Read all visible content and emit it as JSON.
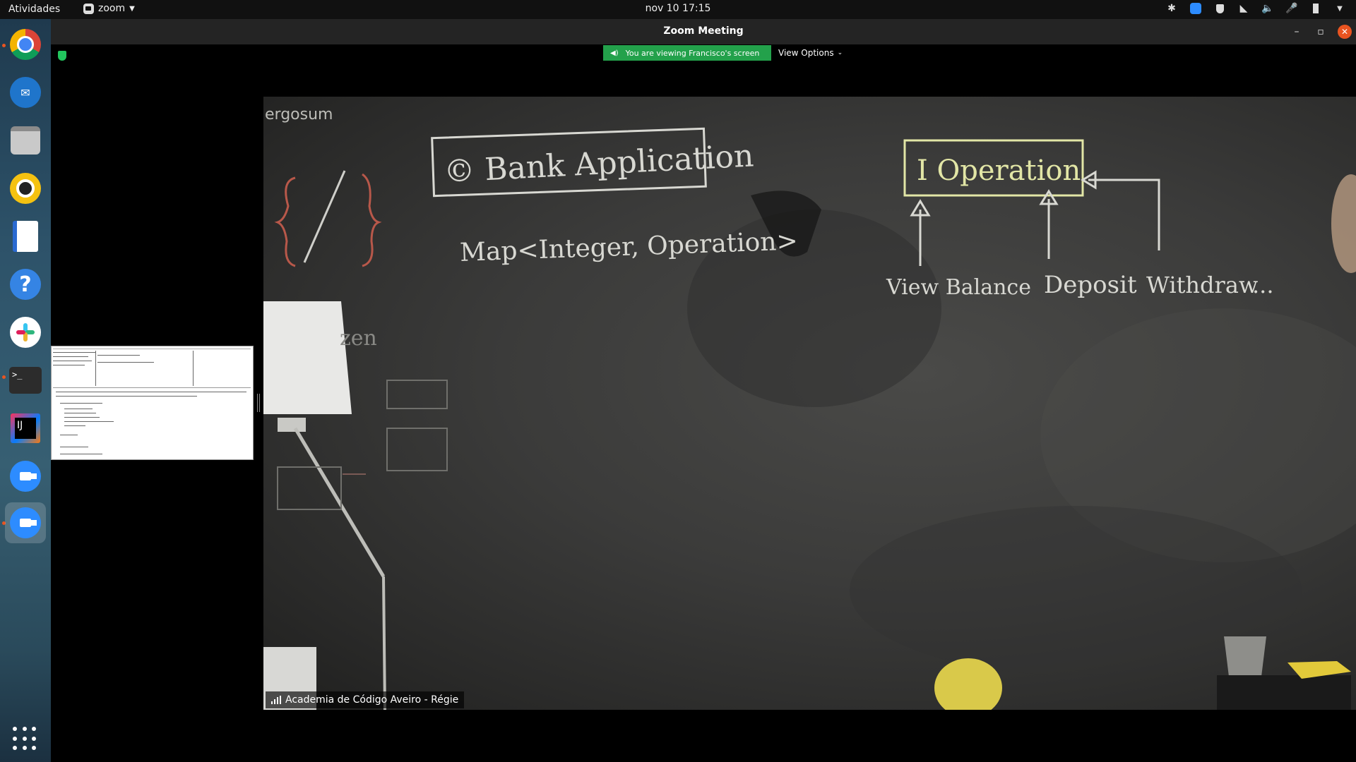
{
  "topbar": {
    "activities": "Atividades",
    "app_name": "zoom",
    "clock": "nov 10  17:15",
    "tray_icons": [
      "slack-tray-icon",
      "zoom-tray-icon",
      "shield-tray-icon",
      "wifi-icon",
      "volume-icon",
      "microphone-icon",
      "battery-icon",
      "system-menu-arrow"
    ]
  },
  "dock": {
    "apps": [
      "google-chrome",
      "thunderbird",
      "files",
      "rhythmbox",
      "libreoffice-writer",
      "help",
      "slack",
      "terminal",
      "intellij-idea",
      "zoom",
      "zoom-meeting"
    ],
    "running": [
      "google-chrome",
      "terminal",
      "zoom-meeting"
    ]
  },
  "zoom": {
    "window_title": "Zoom Meeting",
    "share_banner": "You are viewing Francisco's screen",
    "view_options": "View Options",
    "participant_name": "Academia de Código Aveiro - Régie"
  },
  "chalkboard": {
    "corner_text": "ergosum",
    "title_box": "© Bank Application",
    "interface_box": "I  Operation",
    "map_text": "Map<Integer, Operation>",
    "implementations": [
      "View Balance",
      "Deposit",
      "Withdraw",
      "..."
    ],
    "side_text": "zen"
  },
  "colors": {
    "banner_green": "#23a14b",
    "close_orange": "#e95420",
    "chalk_white": "#d8d8d2",
    "chalk_yellow": "#e2e6a6",
    "chalk_red": "#b8584a"
  }
}
